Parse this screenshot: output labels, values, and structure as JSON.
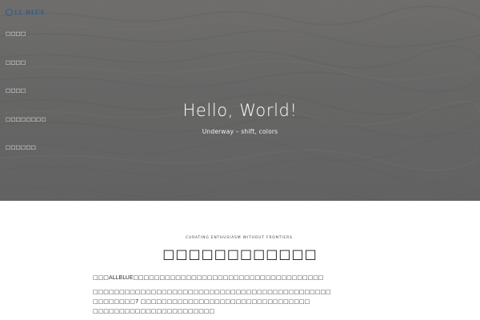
{
  "header": {
    "logo_text": "LL BLUE",
    "logo_icon": "circle-a-logo-icon"
  },
  "nav": {
    "items": [
      {
        "label": "□□□□"
      },
      {
        "label": "□□□□"
      },
      {
        "label": "□□□□"
      },
      {
        "label": "□□□□□□□□"
      },
      {
        "label": "□□□□□□"
      }
    ]
  },
  "hero": {
    "title": "Hello, World!",
    "subtitle": "Underway – shift, colors"
  },
  "content": {
    "tagline": "CURATING ENTHUSIASM WITHOUT FRONTIERS.",
    "section_title": "□□□□□□□□□□□□",
    "paragraph_1": "□□□ALLBLUE□□□□□□□□□□□□□□□□□□□□□□□□□□□□□□□□□□□□",
    "paragraph_2_lines": [
      "□□□□□□□□□□□□□□□□□□□□□□□□□□□□□□□□□□□□□□□□□□□□□",
      "□□□□□□□□7 □□□□□□□□□□□□□□□□□□□□□□□□□□□□□□□□",
      "□□□□□□□□□□□□□□□□□□□□□□□"
    ]
  },
  "colors": {
    "accent": "#2f5b8c",
    "hero_overlay": "#6f6f6f"
  }
}
